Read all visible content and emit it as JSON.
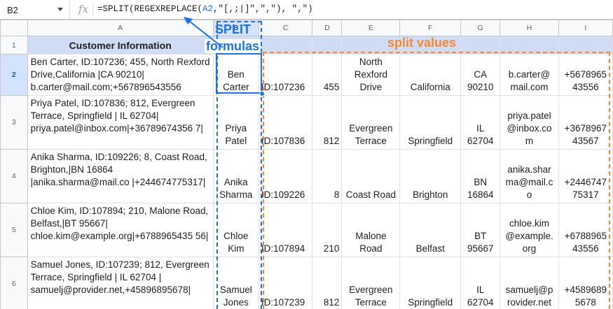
{
  "formula_bar": {
    "cell_ref": "B2",
    "fx_icon": "fx-icon",
    "formula_prefix": "=SPLIT(REGEXREPLACE(",
    "formula_ref": "A2",
    "formula_suffix": ",\"[,;|]\",\",\"), \",\")"
  },
  "columns": [
    "A",
    "B",
    "C",
    "D",
    "E",
    "F",
    "G",
    "H",
    "I"
  ],
  "header_row": {
    "row_num": "1",
    "a1": "Customer Information"
  },
  "annotations": {
    "split": "SPLIT",
    "formulas": "formulas",
    "split_values": "split values"
  },
  "rows": [
    {
      "num": "2",
      "info": "Ben Carter, ID:107236; 455, North Rexford Drive,California |CA 90210| b.carter@mail.com;+567896543556",
      "name": "Ben Carter",
      "id": "ID:107236",
      "num_val": "455",
      "street": "North Rexford Drive",
      "city": "California",
      "state": "CA 90210",
      "email": "b.carter@ mail.com",
      "phone": "+5678965 43556"
    },
    {
      "num": "3",
      "info": "Priya Patel, ID:107836; 812, Evergreen Terrace, Springfield | IL 62704| priya.patel@inbox.com|+36789674356 7|",
      "name": "Priya Patel",
      "id": "ID:107836",
      "num_val": "812",
      "street": "Evergreen Terrace",
      "city": "Springfield",
      "state": "IL 62704",
      "email": "priya.patel @inbox.co m",
      "phone": "+3678967 43567"
    },
    {
      "num": "4",
      "info": "Anika Sharma, ID:109226;  8, Coast Road, Brighton,|BN 16864 |anika.sharma@mail.co |+244674775317|",
      "name": "Anika Sharma",
      "id": "ID:109226",
      "num_val": "8",
      "street": "Coast Road",
      "city": "Brighton",
      "state": "BN 16864",
      "email": "anika.shar ma@mail.c o",
      "phone": "+2446747 75317"
    },
    {
      "num": "5",
      "info": "Chloe Kim, ID:107894; 210, Malone Road, Belfast,|BT 95667| chloe.kim@example.org|+6788965435 56|",
      "name": "Chloe Kim",
      "id": "ID:107894",
      "num_val": "210",
      "street": "Malone Road",
      "city": "Belfast",
      "state": "BT 95667",
      "email": "chloe.kim @example. org",
      "phone": "+6788965 43556"
    },
    {
      "num": "6",
      "info": "Samuel Jones, ID:107239; 812, Evergreen Terrace, Springfield | IL 62704 | samuelj@provider.net,+45896895678|",
      "name": "Samuel Jones",
      "id": "ID:107239",
      "num_val": "812",
      "street": "Evergreen Terrace",
      "city": "Springfield",
      "state": "IL 62704",
      "email": "samuelj@p rovider.net",
      "phone": "+4589689 5678"
    }
  ],
  "colors": {
    "accent_blue": "#1a73e8",
    "accent_orange": "#f28a35",
    "header_fill": "#cfdcf4",
    "selected_header": "#d3e3fd"
  }
}
